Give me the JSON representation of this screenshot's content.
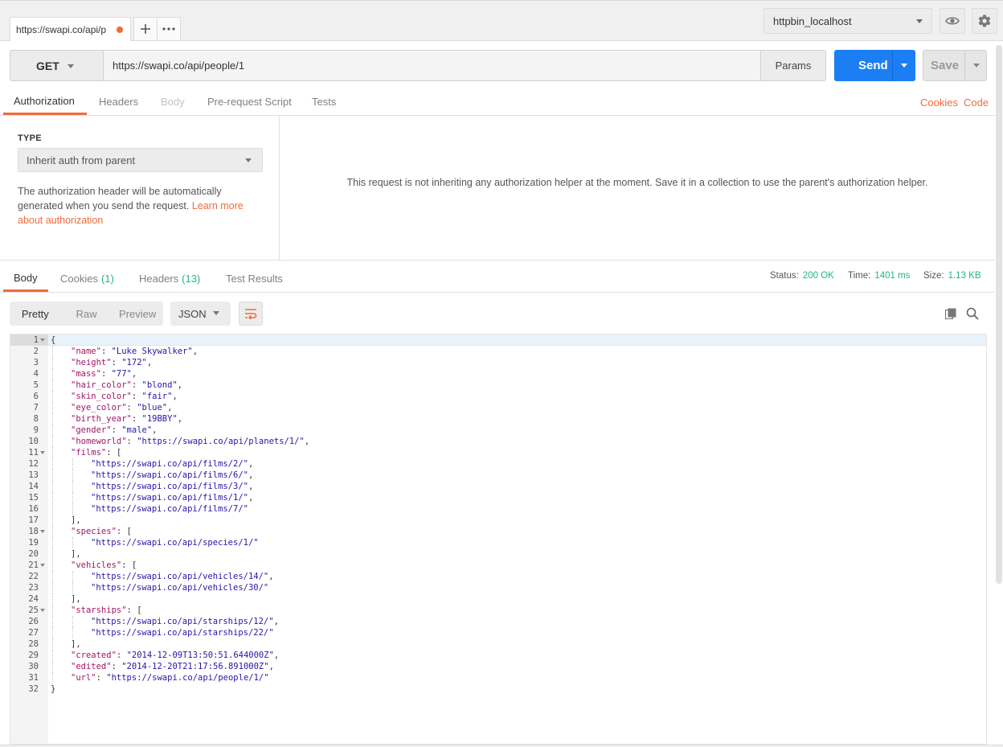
{
  "tab": {
    "label": "https://swapi.co/api/p"
  },
  "environment": {
    "selected": "httpbin_localhost"
  },
  "request": {
    "method": "GET",
    "url": "https://swapi.co/api/people/1",
    "params_label": "Params",
    "send_label": "Send",
    "save_label": "Save"
  },
  "request_tabs": [
    "Authorization",
    "Headers",
    "Body",
    "Pre-request Script",
    "Tests"
  ],
  "links": {
    "cookies": "Cookies",
    "code": "Code"
  },
  "auth": {
    "type_label": "TYPE",
    "type_selected": "Inherit auth from parent",
    "desc_text": "The authorization header will be automatically generated when you send the request. ",
    "desc_link": "Learn more about authorization",
    "message": "This request is not inheriting any authorization helper at the moment. Save it in a collection to use the parent's authorization helper."
  },
  "response_tabs": {
    "body": "Body",
    "cookies": "Cookies",
    "cookies_count": "(1)",
    "headers": "Headers",
    "headers_count": "(13)",
    "tests": "Test Results"
  },
  "status": {
    "status_label": "Status:",
    "status_value": "200 OK",
    "time_label": "Time:",
    "time_value": "1401 ms",
    "size_label": "Size:",
    "size_value": "1.13 KB"
  },
  "view": {
    "pretty": "Pretty",
    "raw": "Raw",
    "preview": "Preview",
    "format": "JSON"
  },
  "colors": {
    "accent": "#f26b3a",
    "send": "#1b7ef2",
    "success": "#26b47f",
    "key": "#a11466",
    "string": "#2a14a8"
  },
  "code_lines": [
    {
      "n": "1",
      "fold": true,
      "indent": 0,
      "parts": [
        [
          "p",
          "{"
        ]
      ]
    },
    {
      "n": "2",
      "indent": 1,
      "parts": [
        [
          "k",
          "\"name\""
        ],
        [
          "p",
          ": "
        ],
        [
          "s",
          "\"Luke Skywalker\""
        ],
        [
          "p",
          ","
        ]
      ]
    },
    {
      "n": "3",
      "indent": 1,
      "parts": [
        [
          "k",
          "\"height\""
        ],
        [
          "p",
          ": "
        ],
        [
          "s",
          "\"172\""
        ],
        [
          "p",
          ","
        ]
      ]
    },
    {
      "n": "4",
      "indent": 1,
      "parts": [
        [
          "k",
          "\"mass\""
        ],
        [
          "p",
          ": "
        ],
        [
          "s",
          "\"77\""
        ],
        [
          "p",
          ","
        ]
      ]
    },
    {
      "n": "5",
      "indent": 1,
      "parts": [
        [
          "k",
          "\"hair_color\""
        ],
        [
          "p",
          ": "
        ],
        [
          "s",
          "\"blond\""
        ],
        [
          "p",
          ","
        ]
      ]
    },
    {
      "n": "6",
      "indent": 1,
      "parts": [
        [
          "k",
          "\"skin_color\""
        ],
        [
          "p",
          ": "
        ],
        [
          "s",
          "\"fair\""
        ],
        [
          "p",
          ","
        ]
      ]
    },
    {
      "n": "7",
      "indent": 1,
      "parts": [
        [
          "k",
          "\"eye_color\""
        ],
        [
          "p",
          ": "
        ],
        [
          "s",
          "\"blue\""
        ],
        [
          "p",
          ","
        ]
      ]
    },
    {
      "n": "8",
      "indent": 1,
      "parts": [
        [
          "k",
          "\"birth_year\""
        ],
        [
          "p",
          ": "
        ],
        [
          "s",
          "\"19BBY\""
        ],
        [
          "p",
          ","
        ]
      ]
    },
    {
      "n": "9",
      "indent": 1,
      "parts": [
        [
          "k",
          "\"gender\""
        ],
        [
          "p",
          ": "
        ],
        [
          "s",
          "\"male\""
        ],
        [
          "p",
          ","
        ]
      ]
    },
    {
      "n": "10",
      "indent": 1,
      "parts": [
        [
          "k",
          "\"homeworld\""
        ],
        [
          "p",
          ": "
        ],
        [
          "s",
          "\"https://swapi.co/api/planets/1/\""
        ],
        [
          "p",
          ","
        ]
      ]
    },
    {
      "n": "11",
      "fold": true,
      "indent": 1,
      "parts": [
        [
          "k",
          "\"films\""
        ],
        [
          "p",
          ": ["
        ]
      ]
    },
    {
      "n": "12",
      "indent": 2,
      "parts": [
        [
          "s",
          "\"https://swapi.co/api/films/2/\""
        ],
        [
          "p",
          ","
        ]
      ]
    },
    {
      "n": "13",
      "indent": 2,
      "parts": [
        [
          "s",
          "\"https://swapi.co/api/films/6/\""
        ],
        [
          "p",
          ","
        ]
      ]
    },
    {
      "n": "14",
      "indent": 2,
      "parts": [
        [
          "s",
          "\"https://swapi.co/api/films/3/\""
        ],
        [
          "p",
          ","
        ]
      ]
    },
    {
      "n": "15",
      "indent": 2,
      "parts": [
        [
          "s",
          "\"https://swapi.co/api/films/1/\""
        ],
        [
          "p",
          ","
        ]
      ]
    },
    {
      "n": "16",
      "indent": 2,
      "parts": [
        [
          "s",
          "\"https://swapi.co/api/films/7/\""
        ]
      ]
    },
    {
      "n": "17",
      "indent": 1,
      "parts": [
        [
          "p",
          "],"
        ]
      ]
    },
    {
      "n": "18",
      "fold": true,
      "indent": 1,
      "parts": [
        [
          "k",
          "\"species\""
        ],
        [
          "p",
          ": ["
        ]
      ]
    },
    {
      "n": "19",
      "indent": 2,
      "parts": [
        [
          "s",
          "\"https://swapi.co/api/species/1/\""
        ]
      ]
    },
    {
      "n": "20",
      "indent": 1,
      "parts": [
        [
          "p",
          "],"
        ]
      ]
    },
    {
      "n": "21",
      "fold": true,
      "indent": 1,
      "parts": [
        [
          "k",
          "\"vehicles\""
        ],
        [
          "p",
          ": ["
        ]
      ]
    },
    {
      "n": "22",
      "indent": 2,
      "parts": [
        [
          "s",
          "\"https://swapi.co/api/vehicles/14/\""
        ],
        [
          "p",
          ","
        ]
      ]
    },
    {
      "n": "23",
      "indent": 2,
      "parts": [
        [
          "s",
          "\"https://swapi.co/api/vehicles/30/\""
        ]
      ]
    },
    {
      "n": "24",
      "indent": 1,
      "parts": [
        [
          "p",
          "],"
        ]
      ]
    },
    {
      "n": "25",
      "fold": true,
      "indent": 1,
      "parts": [
        [
          "k",
          "\"starships\""
        ],
        [
          "p",
          ": ["
        ]
      ]
    },
    {
      "n": "26",
      "indent": 2,
      "parts": [
        [
          "s",
          "\"https://swapi.co/api/starships/12/\""
        ],
        [
          "p",
          ","
        ]
      ]
    },
    {
      "n": "27",
      "indent": 2,
      "parts": [
        [
          "s",
          "\"https://swapi.co/api/starships/22/\""
        ]
      ]
    },
    {
      "n": "28",
      "indent": 1,
      "parts": [
        [
          "p",
          "],"
        ]
      ]
    },
    {
      "n": "29",
      "indent": 1,
      "parts": [
        [
          "k",
          "\"created\""
        ],
        [
          "p",
          ": "
        ],
        [
          "s",
          "\"2014-12-09T13:50:51.644000Z\""
        ],
        [
          "p",
          ","
        ]
      ]
    },
    {
      "n": "30",
      "indent": 1,
      "parts": [
        [
          "k",
          "\"edited\""
        ],
        [
          "p",
          ": "
        ],
        [
          "s",
          "\"2014-12-20T21:17:56.891000Z\""
        ],
        [
          "p",
          ","
        ]
      ]
    },
    {
      "n": "31",
      "indent": 1,
      "parts": [
        [
          "k",
          "\"url\""
        ],
        [
          "p",
          ": "
        ],
        [
          "s",
          "\"https://swapi.co/api/people/1/\""
        ]
      ]
    },
    {
      "n": "32",
      "indent": 0,
      "parts": [
        [
          "p",
          "}"
        ]
      ]
    }
  ]
}
